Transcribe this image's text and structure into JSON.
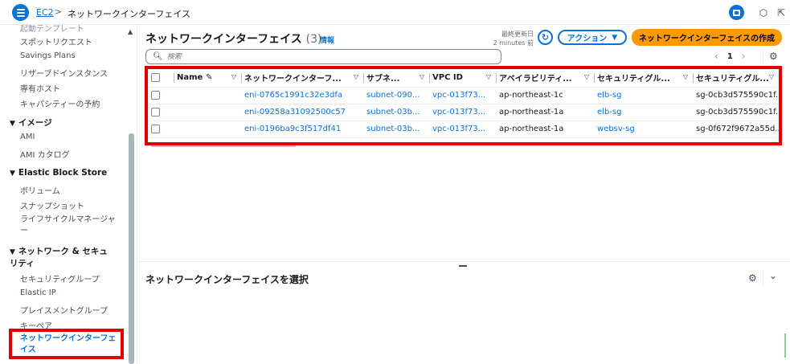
{
  "topbar": {
    "breadcrumb_root": "EC2",
    "breadcrumb_sep": ">",
    "breadcrumb_current": "ネットワークインターフェイス"
  },
  "sidebar": {
    "items": [
      {
        "label": "起動テンプレート",
        "type": "item"
      },
      {
        "label": "スポットリクエスト",
        "type": "item"
      },
      {
        "label": "Savings Plans",
        "type": "item"
      },
      {
        "label": "リザーブドインスタンス",
        "type": "item"
      },
      {
        "label": "専有ホスト",
        "type": "item"
      },
      {
        "label": "キャパシティーの予約",
        "type": "item"
      },
      {
        "label": "イメージ",
        "type": "head"
      },
      {
        "label": "AMI",
        "type": "item"
      },
      {
        "label": "AMI カタログ",
        "type": "item"
      },
      {
        "label": "Elastic Block Store",
        "type": "head"
      },
      {
        "label": "ボリューム",
        "type": "item"
      },
      {
        "label": "スナップショット",
        "type": "item"
      },
      {
        "label": "ライフサイクルマネージャー",
        "type": "item"
      },
      {
        "label": "ネットワーク & セキュリティ",
        "type": "head"
      },
      {
        "label": "セキュリティグループ",
        "type": "item"
      },
      {
        "label": "Elastic IP",
        "type": "item"
      },
      {
        "label": "プレイスメントグループ",
        "type": "item"
      },
      {
        "label": "キーペア",
        "type": "item"
      },
      {
        "label": "ネットワークインターフェイス",
        "type": "active"
      }
    ]
  },
  "header": {
    "title": "ネットワークインターフェイス",
    "count": "(3)",
    "info": "情報",
    "updated_label": "最終更新日",
    "updated_value": "2 minutes 前",
    "actions_label": "アクション",
    "create_label": "ネットワークインターフェイスの作成"
  },
  "search": {
    "placeholder": "検索"
  },
  "pagination": {
    "page": "1"
  },
  "table": {
    "columns": [
      "Name",
      "ネットワークインターフ...",
      "サブネ...",
      "VPC ID",
      "アベイラビリティ...",
      "セキュリティグル...",
      "セキュリティグル..."
    ],
    "rows": [
      [
        "",
        "eni-0765c1991c32e3dfa",
        "subnet-090...",
        "vpc-013f73...",
        "ap-northeast-1c",
        "elb-sg",
        "sg-0cb3d575590c1f..."
      ],
      [
        "",
        "eni-09258a31092500c57",
        "subnet-03b...",
        "vpc-013f73...",
        "ap-northeast-1a",
        "elb-sg",
        "sg-0cb3d575590c1f..."
      ],
      [
        "",
        "eni-0196ba9c3f517df41",
        "subnet-03b...",
        "vpc-013f73...",
        "ap-northeast-1a",
        "websv-sg",
        "sg-0f672f9672a55d..."
      ]
    ]
  },
  "bottom_panel": {
    "title": "ネットワークインターフェイスを選択"
  },
  "icons": {
    "accent": "#0972d3",
    "primary_button": "#ff9900",
    "highlight": "#e00000"
  }
}
